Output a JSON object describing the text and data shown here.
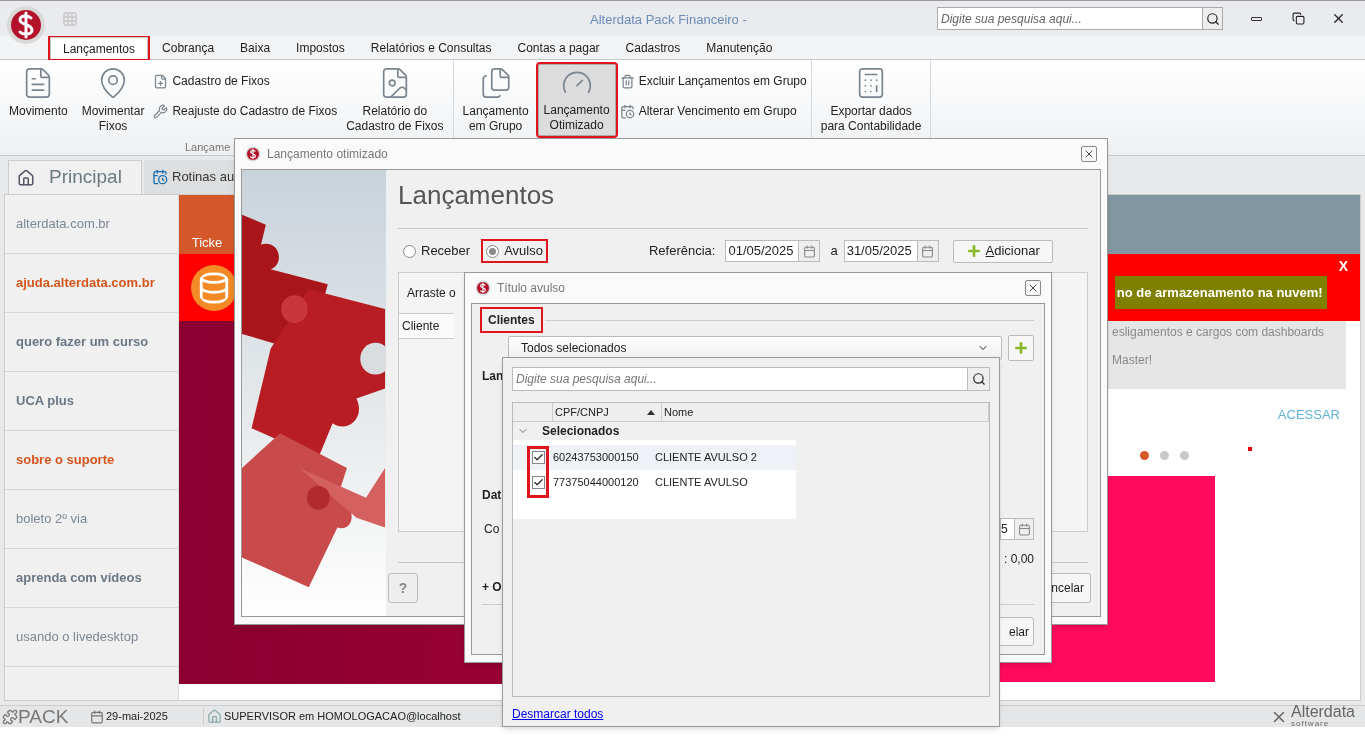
{
  "app": {
    "title": "Alterdata Pack Financeiro -",
    "search_placeholder": "Digite sua pesquisa aqui..."
  },
  "menu_tabs": [
    {
      "label": "Lançamentos",
      "selected": true,
      "highlighted": true
    },
    {
      "label": "Cobrança",
      "selected": false,
      "highlighted": false
    },
    {
      "label": "Baixa",
      "selected": false,
      "highlighted": false
    },
    {
      "label": "Impostos",
      "selected": false,
      "highlighted": false
    },
    {
      "label": "Relatórios e Consultas",
      "selected": false,
      "highlighted": false
    },
    {
      "label": "Contas a pagar",
      "selected": false,
      "highlighted": false
    },
    {
      "label": "Cadastros",
      "selected": false,
      "highlighted": false
    },
    {
      "label": "Manutenção",
      "selected": false,
      "highlighted": false
    }
  ],
  "ribbon": [
    {
      "label": "Lançame",
      "items": [
        {
          "kind": "large",
          "label": "Movimento",
          "pressed": false,
          "highlighted": false
        },
        {
          "kind": "large",
          "label": "Movimentar\nFixos",
          "pressed": false,
          "highlighted": false
        },
        {
          "kind": "stack",
          "items": [
            {
              "label": "Cadastro de Fixos"
            },
            {
              "label": "Reajuste do Cadastro de Fixos"
            }
          ]
        },
        {
          "kind": "large",
          "label": "Relatório do\nCadastro de Fixos",
          "pressed": false,
          "highlighted": false
        }
      ]
    },
    {
      "items": [
        {
          "kind": "large",
          "label": "Lançamento\nem Grupo",
          "pressed": false,
          "highlighted": false
        },
        {
          "kind": "large",
          "label": "Lançamento\nOtimizado",
          "pressed": true,
          "highlighted": true
        },
        {
          "kind": "stack",
          "items": [
            {
              "label": "Excluir Lançamentos em Grupo"
            },
            {
              "label": "Alterar Vencimento em Grupo"
            }
          ]
        }
      ]
    },
    {
      "items": [
        {
          "kind": "large",
          "label": "Exportar dados\npara Contabilidade",
          "pressed": false,
          "highlighted": false
        }
      ]
    }
  ],
  "page_tabs": [
    {
      "label": "Principal",
      "selected": true
    },
    {
      "label": "Rotinas au",
      "selected": false
    }
  ],
  "sidebar_links": [
    {
      "label": "alterdata.com.br",
      "kind": "plain"
    },
    {
      "label": "ajuda.alterdata.com.br",
      "kind": "accent"
    },
    {
      "label": "quero fazer um curso",
      "kind": "bold"
    },
    {
      "label": "UCA plus",
      "kind": "bold"
    },
    {
      "label": "sobre o suporte",
      "kind": "accent"
    },
    {
      "label": "boleto 2º via",
      "kind": "plain"
    },
    {
      "label": "aprenda com vídeos",
      "kind": "bold"
    },
    {
      "label": "usando o livedesktop",
      "kind": "plain"
    }
  ],
  "home": {
    "tile_label": "Ticke",
    "promo_text": "no de armazenamento na nuvem!",
    "promo_close": "X",
    "news_lines": [
      "esligamentos e cargos com dashboards",
      "Master!"
    ],
    "news_link": "ACESSAR",
    "carousel": [
      {
        "selected": true
      },
      {
        "selected": false
      },
      {
        "selected": false
      }
    ]
  },
  "dialog_main": {
    "title": "Lançamento otimizado",
    "heading": "Lançamentos",
    "radios": [
      {
        "label": "Receber",
        "selected": false,
        "highlighted": false
      },
      {
        "label": "Avulso",
        "selected": true,
        "highlighted": true
      }
    ],
    "reference_label": "Referência:",
    "date_from": "01/05/2025",
    "date_separator": "a",
    "date_to": "31/05/2025",
    "add_button": "Adicionar",
    "grid_hint": "Arraste o",
    "grid_column": "Cliente",
    "help_button": "?",
    "cancel_button": "ncelar"
  },
  "dialog_title": {
    "title": "Título avulso",
    "section": "Clientes",
    "section_highlighted": true,
    "combo_value": "Todos selecionados",
    "label_1": "Lan",
    "label_2": "Dat",
    "label_3": "Co",
    "date_value": "5",
    "total": ": 0,00",
    "expand_label": "+ O",
    "cancel_button": "elar"
  },
  "dropdown": {
    "search_placeholder": "Digite sua pesquisa aqui...",
    "columns": [
      {
        "label": "CPF/CNPJ",
        "sorted": true
      },
      {
        "label": "Nome",
        "sorted": false
      }
    ],
    "group": {
      "label": "Selecionados",
      "expanded": true
    },
    "checkboxes_highlighted": true,
    "rows": [
      {
        "checked": true,
        "cpf": "60243753000150",
        "name": "CLIENTE AVULSO 2"
      },
      {
        "checked": true,
        "cpf": "77375044000120",
        "name": "CLIENTE AVULSO"
      }
    ],
    "footer_link": "Desmarcar todos"
  },
  "status_bar": {
    "product": "PACK",
    "date": "29-mai-2025",
    "user": "SUPERVISOR em HOMOLOGACAO@localhost",
    "logo": "Alterdata",
    "logo_sub": "software"
  }
}
